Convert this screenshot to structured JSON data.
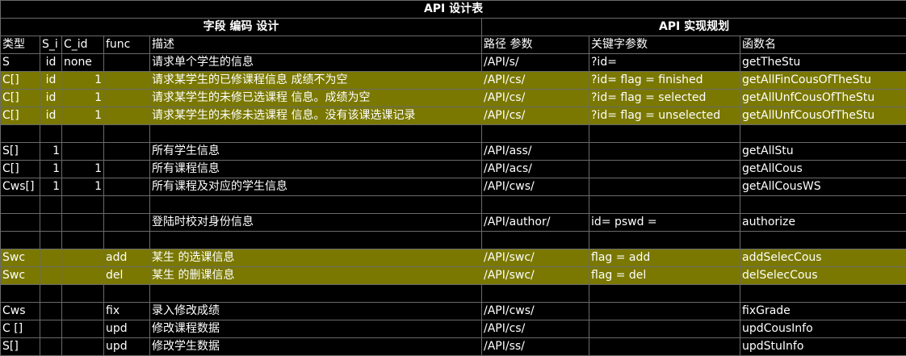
{
  "title": "API 设计表",
  "group_left": "字段 编码 设计",
  "group_right": "API 实现规划",
  "columns": [
    "类型",
    "S_i",
    "C_id",
    "func",
    "描述",
    "路径 参数",
    "关键字参数",
    "函数名"
  ],
  "rows": [
    {
      "cells": [
        "S",
        "id",
        "none",
        "",
        "请求单个学生的信息",
        "/API/s/",
        "?id=",
        "getTheStu"
      ],
      "hl": false
    },
    {
      "cells": [
        "C[]",
        "id",
        "1",
        "",
        "请求某学生的已修课程信息  成绩不为空",
        "/API/cs/",
        "?id=    flag = finished",
        "getAllFinCousOfTheStu"
      ],
      "hl": true
    },
    {
      "cells": [
        "C[]",
        "id",
        "1",
        "",
        "请求某学生的未修已选课程 信息。成绩为空",
        "/API/cs/",
        "?id=    flag = selected",
        "getAllUnfCousOfTheStu"
      ],
      "hl": true
    },
    {
      "cells": [
        "C[]",
        "id",
        "1",
        "",
        "请求某学生的未修未选课程 信息。没有该课选课记录",
        "/API/cs/",
        "?id=    flag = unselected",
        "getAllUnfCousOfTheStu"
      ],
      "hl": true
    },
    {
      "cells": [
        "",
        "",
        "",
        "",
        "",
        "",
        "",
        ""
      ],
      "hl": false
    },
    {
      "cells": [
        "S[]",
        "1",
        "",
        "",
        "所有学生信息",
        "/API/ass/",
        "",
        "getAllStu"
      ],
      "hl": false
    },
    {
      "cells": [
        "C[]",
        "1",
        "1",
        "",
        "所有课程信息",
        "/API/acs/",
        "",
        "getAllCous"
      ],
      "hl": false
    },
    {
      "cells": [
        "Cws[]",
        "1",
        "1",
        "",
        "所有课程及对应的学生信息",
        "/API/cws/",
        "",
        "getAllCousWS"
      ],
      "hl": false
    },
    {
      "cells": [
        "",
        "",
        "",
        "",
        "",
        "",
        "",
        ""
      ],
      "hl": false
    },
    {
      "cells": [
        "",
        "",
        "",
        "",
        "登陆时校对身份信息",
        "/API/author/",
        "id=   pswd =",
        "authorize"
      ],
      "hl": false
    },
    {
      "cells": [
        "",
        "",
        "",
        "",
        "",
        "",
        "",
        ""
      ],
      "hl": false
    },
    {
      "cells": [
        "Swc",
        "",
        "",
        "add",
        "某生 的选课信息",
        "/API/swc/",
        "flag = add",
        "addSelecCous"
      ],
      "hl": true
    },
    {
      "cells": [
        "Swc",
        "",
        "",
        "del",
        "某生 的删课信息",
        "/API/swc/",
        "flag = del",
        "delSelecCous"
      ],
      "hl": true
    },
    {
      "cells": [
        "",
        "",
        "",
        "",
        "",
        "",
        "",
        ""
      ],
      "hl": false
    },
    {
      "cells": [
        "Cws",
        "",
        "",
        "fix",
        "录入修改成绩",
        "/API/cws/",
        "",
        "fixGrade"
      ],
      "hl": false
    },
    {
      "cells": [
        "C []",
        "",
        "",
        "upd",
        "修改课程数据",
        "/API/cs/",
        "",
        "updCousInfo"
      ],
      "hl": false
    },
    {
      "cells": [
        "S[]",
        "",
        "",
        "upd",
        "修改学生数据",
        "/API/ss/",
        "",
        "updStuInfo"
      ],
      "hl": false
    }
  ]
}
